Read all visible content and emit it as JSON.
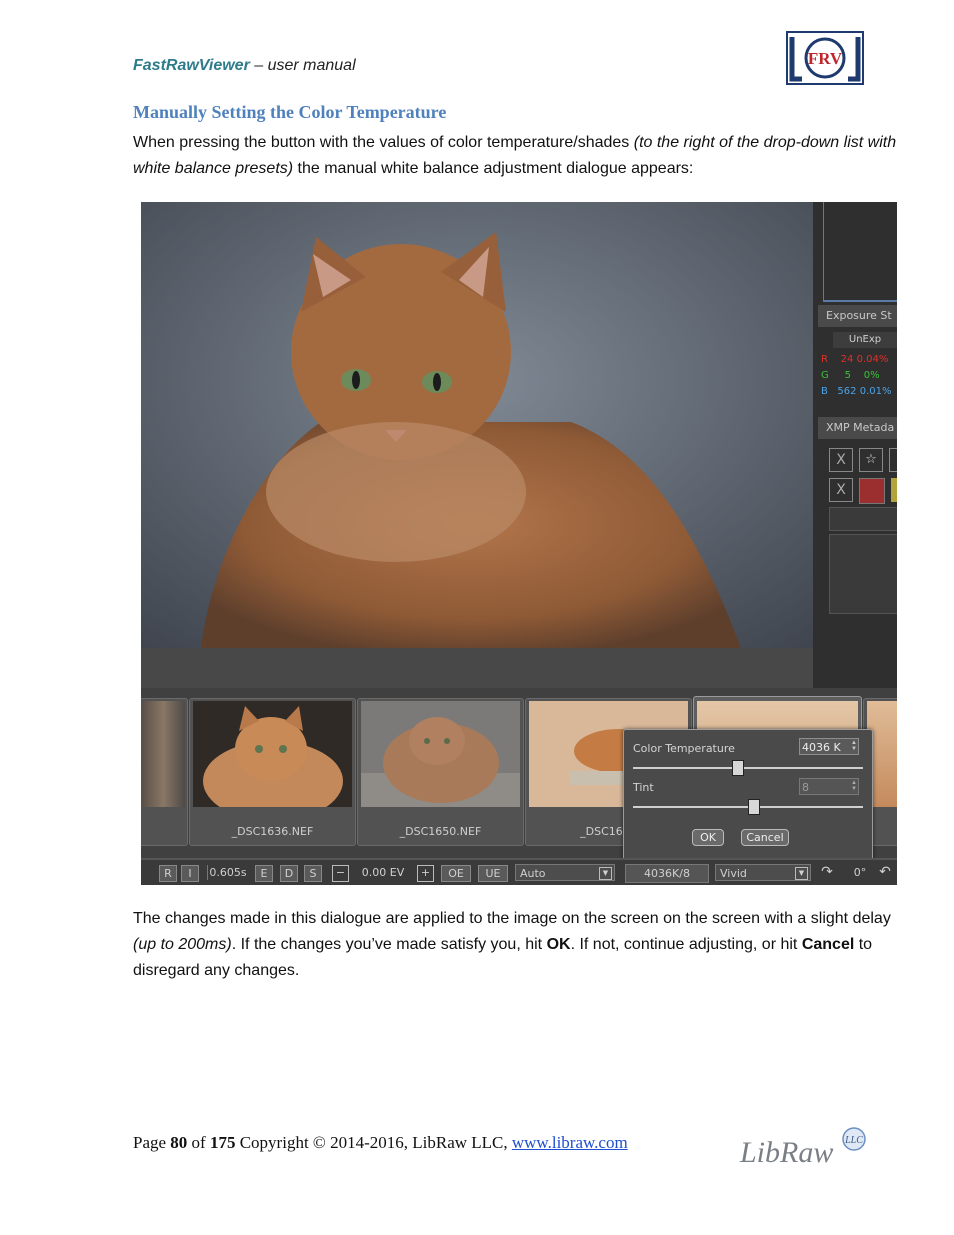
{
  "header": {
    "brand": "FastRawViewer",
    "subtitle": " – user manual",
    "logo_text": "FRV"
  },
  "section_title": "Manually Setting the Color Temperature",
  "intro": {
    "p1": "When pressing the button with the values of color temperature/shades ",
    "p1_italic": "(to the right of the drop-down list with white balance presets)",
    "p1_end": " the manual white balance adjustment dialogue appears:"
  },
  "screenshot": {
    "right_panel": {
      "exposure_title": "Exposure St",
      "unexp_label": "UnExp",
      "rows": [
        {
          "ch": "R",
          "v1": "24",
          "v2": "0.04%",
          "color": "#e0302a"
        },
        {
          "ch": "G",
          "v1": "5",
          "v2": "0%",
          "color": "#39c23a"
        },
        {
          "ch": "B",
          "v1": "562",
          "v2": "0.01%",
          "color": "#4aa3e8"
        }
      ],
      "xmp_title": "XMP Metada",
      "x_label": "X",
      "star_label": "☆"
    },
    "filmstrip": [
      {
        "name": ""
      },
      {
        "name": "_DSC1636.NEF"
      },
      {
        "name": "_DSC1650.NEF"
      },
      {
        "name": "_DSC1681"
      },
      {
        "name": ""
      }
    ],
    "dialog": {
      "temp_label": "Color Temperature",
      "temp_value": "4036 K",
      "tint_label": "Tint",
      "tint_value": "8",
      "ok_label": "OK",
      "cancel_label": "Cancel",
      "temp_slider": 0.45,
      "tint_slider": 0.52
    },
    "statusbar": {
      "r": "R",
      "i": "I",
      "shutter": "0.605s",
      "e": "E",
      "d": "D",
      "s": "S",
      "minus": "−",
      "ev": "0.00 EV",
      "plus": "+",
      "oe": "OE",
      "ue": "UE",
      "wb_preset": "Auto",
      "wb_value": "4036K/8",
      "profile": "Vivid",
      "rotation": "0°"
    }
  },
  "body_text": {
    "p2_a": "The changes made in this dialogue are applied to the image on the screen on the screen with a slight delay ",
    "p2_italic": "(up to 200ms)",
    "p2_b": ". If the changes you’ve made satisfy you, hit ",
    "ok": "OK",
    "p2_c": ". If not, continue adjusting, or hit ",
    "cancel": "Cancel",
    "p2_d": " to disregard any changes."
  },
  "footer": {
    "page_prefix": "Page ",
    "page": "80",
    "of": " of ",
    "total": "175",
    "copyright": " Copyright © 2014-2016, LibRaw LLC, ",
    "link": "www.libraw.com",
    "logo_text": "LibRaw",
    "logo_badge": "LLC"
  }
}
